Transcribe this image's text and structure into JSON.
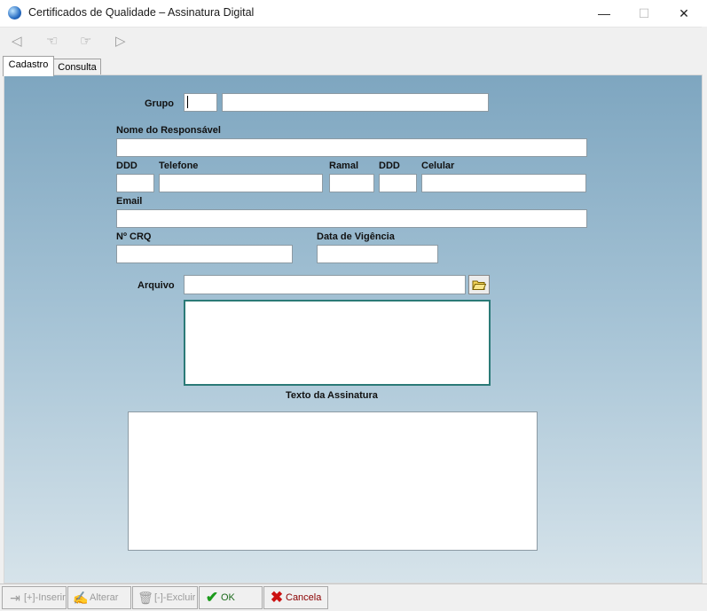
{
  "window": {
    "title": "Certificados de Qualidade – Assinatura Digital",
    "minimize": "—",
    "maximize": "☐",
    "close": "✕"
  },
  "toolbar": {
    "first": "◁",
    "prev": "☜",
    "next": "☞",
    "last": "▷"
  },
  "tabs": [
    {
      "label": "Cadastro"
    },
    {
      "label": "Consulta"
    }
  ],
  "form": {
    "grupo_label": "Grupo",
    "nome_label": "Nome do Responsável",
    "ddd_label": "DDD",
    "telefone_label": "Telefone",
    "ramal_label": "Ramal",
    "ddd2_label": "DDD",
    "celular_label": "Celular",
    "email_label": "Email",
    "crq_label": "Nº CRQ",
    "vigencia_label": "Data de Vigência",
    "arquivo_label": "Arquivo",
    "texto_label": "Texto da Assinatura"
  },
  "actions": {
    "inserir": "[+]-Inserir",
    "alterar": "Alterar",
    "excluir": "[-]-Excluir",
    "ok": "OK",
    "cancela": "Cancela"
  },
  "colors": {
    "panel_top": "#7ea6c0",
    "panel_bottom": "#d6e3ea",
    "ok_green": "#1b9a1b",
    "cancel_red": "#cc1111"
  }
}
